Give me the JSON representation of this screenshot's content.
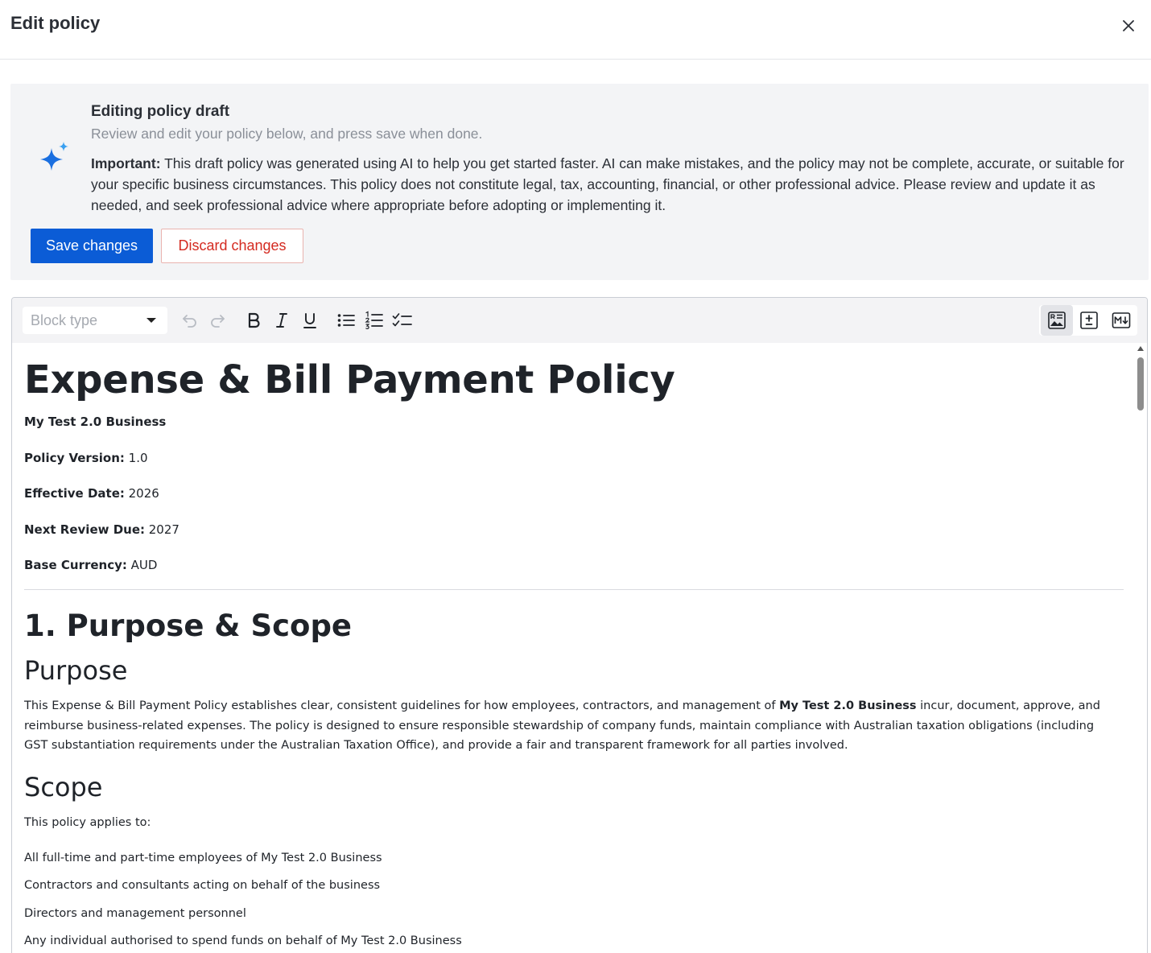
{
  "header": {
    "title": "Edit policy"
  },
  "banner": {
    "title": "Editing policy draft",
    "subtitle": "Review and edit your policy below, and press save when done.",
    "important_label": "Important:",
    "important_text": " This draft policy was generated using AI to help you get started faster. AI can make mistakes, and the policy may not be complete, accurate, or suitable for your specific business circumstances. This policy does not constitute legal, tax, accounting, financial, or other professional advice. Please review and update it as needed, and seek professional advice where appropriate before adopting or implementing it.",
    "save_label": "Save changes",
    "discard_label": "Discard changes"
  },
  "toolbar": {
    "block_type_placeholder": "Block type",
    "icons": [
      "undo-icon",
      "redo-icon",
      "bold-icon",
      "italic-icon",
      "underline-icon",
      "bullet-list-icon",
      "numbered-list-icon",
      "checklist-icon",
      "rich-text-mode-icon",
      "diff-mode-icon",
      "markdown-mode-icon"
    ]
  },
  "document": {
    "title": "Expense & Bill Payment Policy",
    "business_name": "My Test 2.0 Business",
    "meta": [
      {
        "label": "Policy Version:",
        "value": " 1.0"
      },
      {
        "label": "Effective Date:",
        "value": " 2026"
      },
      {
        "label": "Next Review Due:",
        "value": " 2027"
      },
      {
        "label": "Base Currency:",
        "value": " AUD"
      }
    ],
    "section1_heading": "1. Purpose & Scope",
    "purpose_heading": "Purpose",
    "purpose_text_before": "This Expense & Bill Payment Policy establishes clear, consistent guidelines for how employees, contractors, and management of ",
    "purpose_text_bold": "My Test 2.0 Business",
    "purpose_text_after": " incur, document, approve, and reimburse business-related expenses. The policy is designed to ensure responsible stewardship of company funds, maintain compliance with Australian taxation obligations (including GST substantiation requirements under the Australian Taxation Office), and provide a fair and transparent framework for all parties involved.",
    "scope_heading": "Scope",
    "scope_intro": "This policy applies to:",
    "scope_items": [
      "All full-time and part-time employees of My Test 2.0 Business",
      "Contractors and consultants acting on behalf of the business",
      "Directors and management personnel",
      "Any individual authorised to spend funds on behalf of My Test 2.0 Business"
    ]
  },
  "colors": {
    "primary": "#0b5cd6",
    "danger": "#d42a20",
    "sparkle": "#1a6fe0"
  }
}
